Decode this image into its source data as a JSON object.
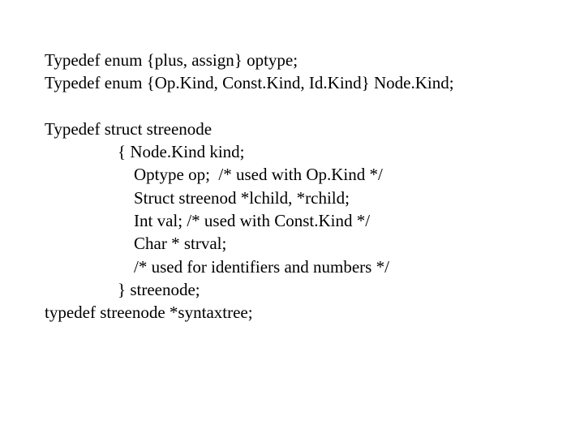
{
  "code": {
    "line1": "Typedef enum {plus, assign} optype;",
    "line2": "Typedef enum {Op.Kind, Const.Kind, Id.Kind} Node.Kind;",
    "line3": "Typedef struct streenode",
    "line4": "{ Node.Kind kind;",
    "line5": "Optype op;  /* used with Op.Kind */",
    "line6": "Struct streenod *lchild, *rchild;",
    "line7": "Int val; /* used with Const.Kind */",
    "line8": "Char * strval;",
    "line9": "/* used for identifiers and numbers */",
    "line10": "} streenode;",
    "line11": "typedef streenode *syntaxtree;"
  }
}
